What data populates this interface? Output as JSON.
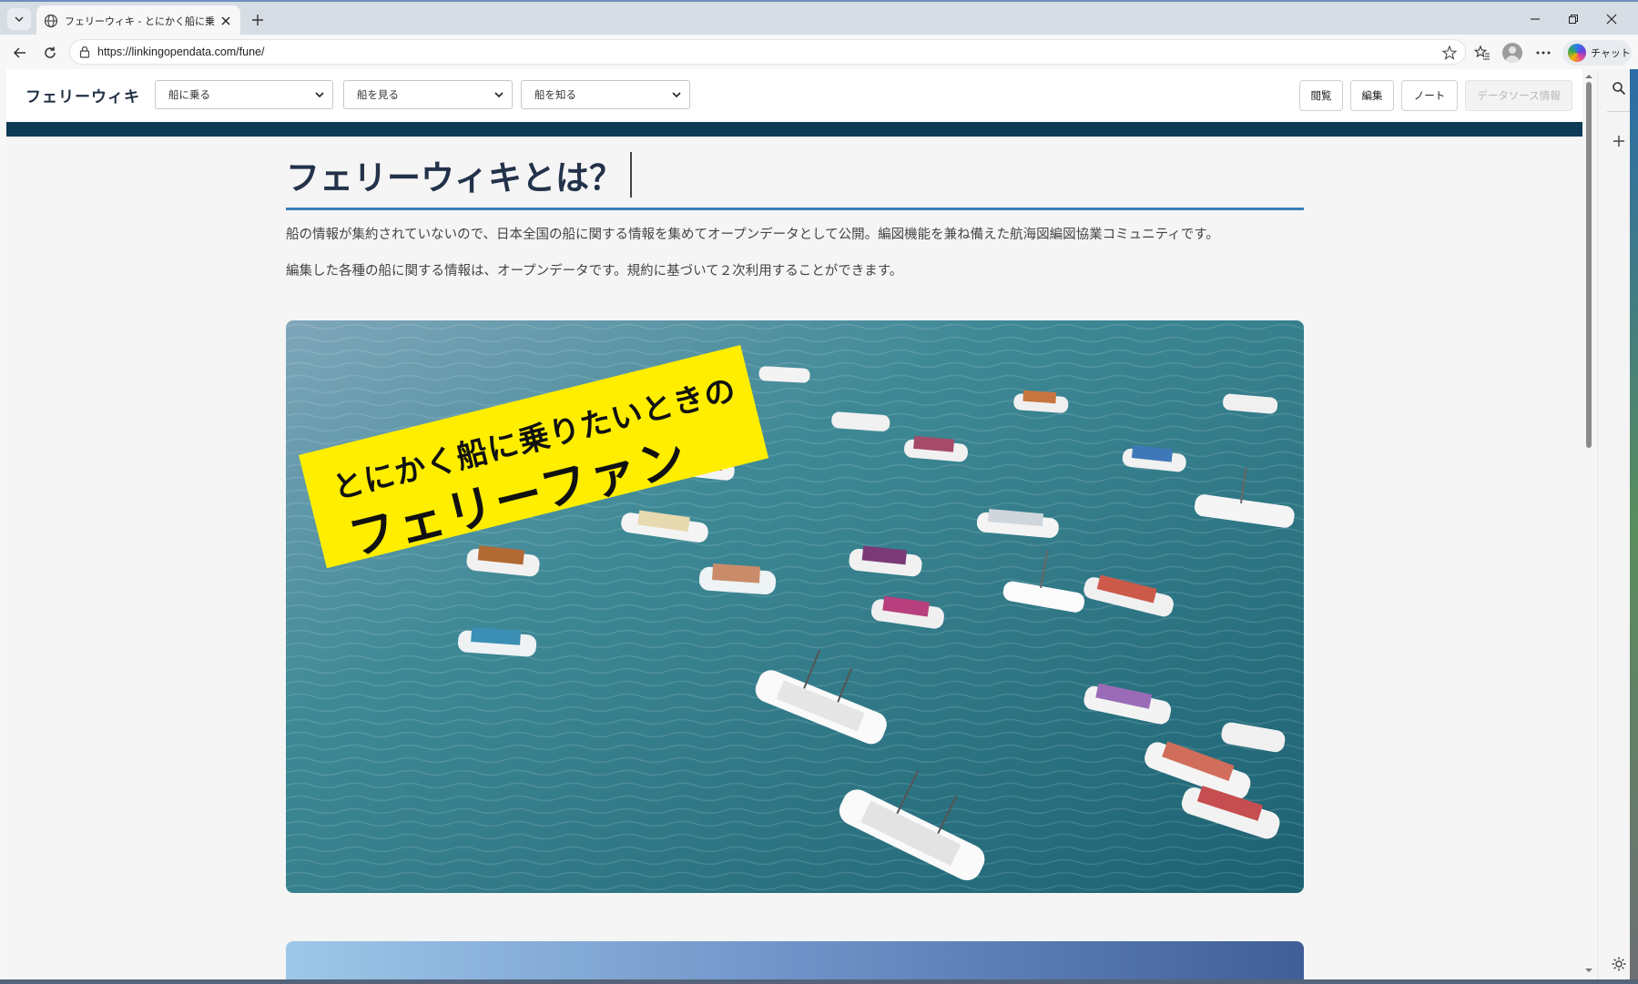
{
  "browser": {
    "tab_title": "フェリーウィキ - とにかく船に乗りたいときのフェリーファン",
    "url": "https://linkingopendata.com/fune/",
    "chat_label": "チャット"
  },
  "site": {
    "logo": "フェリーウィキ",
    "nav_selects": [
      {
        "value": "船に乗る"
      },
      {
        "value": "船を見る"
      },
      {
        "value": "船を知る"
      }
    ],
    "header_buttons": {
      "view": "閲覧",
      "edit": "編集",
      "note": "ノート",
      "datasource": "データソース情報"
    }
  },
  "content": {
    "heading": "フェリーウィキとは？",
    "paragraph1": "船の情報が集約されていないので、日本全国の船に関する情報を集めてオープンデータとして公開。編図機能を兼ね備えた航海図編図協業コミュニティです。",
    "paragraph2": "編集した各種の船に関する情報は、オープンデータです。規約に基づいて２次利用することができます。",
    "hero": {
      "line1": "とにかく船に乗りたいときの",
      "line2": "フェリーファン"
    }
  },
  "colors": {
    "header_band": "#0d3b55",
    "heading_rule": "#3b7fb8",
    "hero_banner": "#ffee00",
    "sea": "#2f7f8c"
  }
}
